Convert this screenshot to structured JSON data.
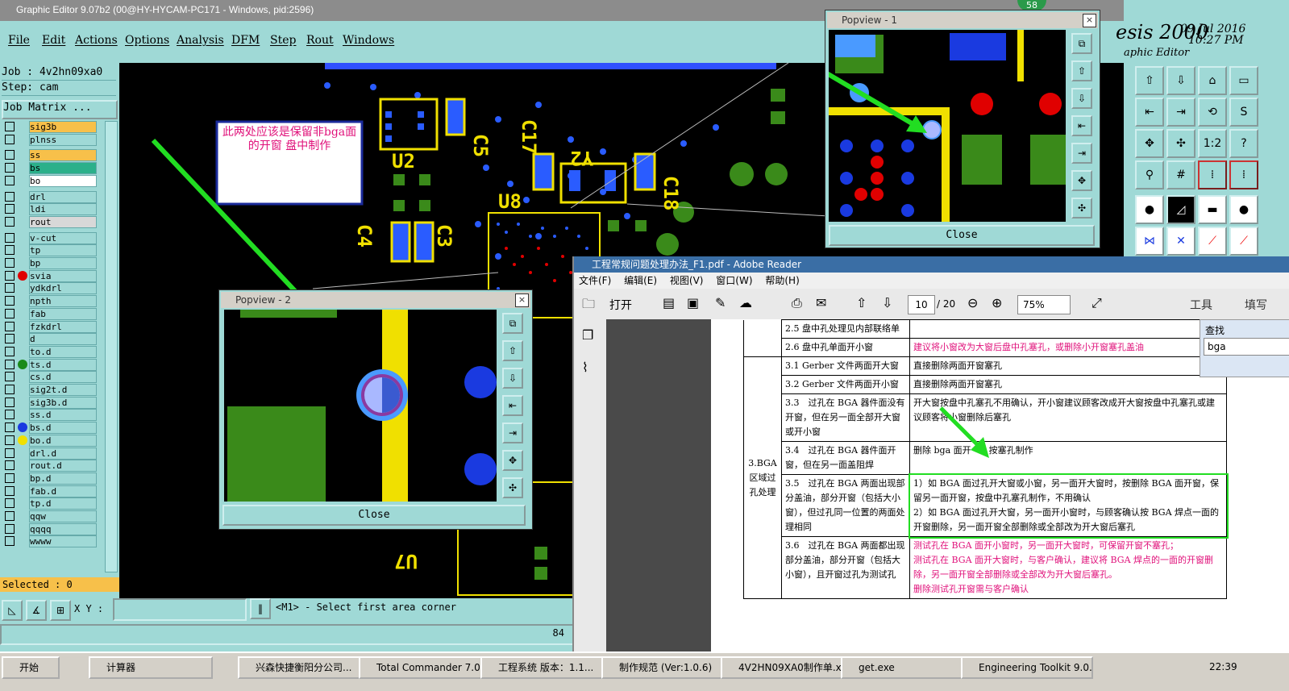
{
  "window": {
    "title": "Graphic Editor 9.07b2 (00@HY-HYCAM-PC171 - Windows, pid:2596)",
    "badge": "58"
  },
  "menu": [
    "File",
    "Edit",
    "Actions",
    "Options",
    "Analysis",
    "DFM",
    "Step",
    "Rout",
    "Windows"
  ],
  "left": {
    "job": "Job : 4v2hn09xa0",
    "step": "Step: cam",
    "job_matrix": "Job Matrix ...",
    "selected": "Selected : 0",
    "layers": [
      {
        "name": "sig3b",
        "bg": "#f7c04a"
      },
      {
        "name": "plnss",
        "bg": "#9fd9d6"
      },
      {
        "name": "ss",
        "bg": "#f7c04a"
      },
      {
        "name": "bs",
        "bg": "#2bb08a"
      },
      {
        "name": "bo",
        "bg": "#ffffff"
      },
      {
        "name": "drl",
        "bg": "#9fd9d6"
      },
      {
        "name": "ldi",
        "bg": "#9fd9d6"
      },
      {
        "name": "rout",
        "bg": "#d8d8d8"
      },
      {
        "name": "v-cut",
        "bg": "#9fd9d6"
      },
      {
        "name": "tp",
        "bg": "#9fd9d6"
      },
      {
        "name": "bp",
        "bg": "#9fd9d6"
      },
      {
        "name": "svia",
        "bg": "#9fd9d6",
        "dot": "#e00000"
      },
      {
        "name": "ydkdrl",
        "bg": "#9fd9d6"
      },
      {
        "name": "npth",
        "bg": "#9fd9d6"
      },
      {
        "name": "fab",
        "bg": "#9fd9d6"
      },
      {
        "name": "fzkdrl",
        "bg": "#9fd9d6"
      },
      {
        "name": "d",
        "bg": "#9fd9d6"
      },
      {
        "name": "to.d",
        "bg": "#9fd9d6"
      },
      {
        "name": "ts.d",
        "bg": "#9fd9d6",
        "dot": "#1a8a1a"
      },
      {
        "name": "cs.d",
        "bg": "#9fd9d6"
      },
      {
        "name": "sig2t.d",
        "bg": "#9fd9d6"
      },
      {
        "name": "sig3b.d",
        "bg": "#9fd9d6"
      },
      {
        "name": "ss.d",
        "bg": "#9fd9d6"
      },
      {
        "name": "bs.d",
        "bg": "#9fd9d6",
        "dot": "#1a3ae0"
      },
      {
        "name": "bo.d",
        "bg": "#9fd9d6",
        "dot": "#f0e000"
      },
      {
        "name": "drl.d",
        "bg": "#9fd9d6"
      },
      {
        "name": "rout.d",
        "bg": "#9fd9d6"
      },
      {
        "name": "bp.d",
        "bg": "#9fd9d6"
      },
      {
        "name": "fab.d",
        "bg": "#9fd9d6"
      },
      {
        "name": "tp.d",
        "bg": "#9fd9d6"
      },
      {
        "name": "qqw",
        "bg": "#9fd9d6"
      },
      {
        "name": "qqqq",
        "bg": "#9fd9d6"
      },
      {
        "name": "wwww",
        "bg": "#9fd9d6"
      }
    ]
  },
  "canvas": {
    "note": "此两处应该是保留非bga面的开窗    盘中制作",
    "labels": [
      "C5",
      "C17",
      "Y2",
      "U2",
      "U8",
      "C18",
      "C4",
      "C3",
      "U7"
    ]
  },
  "bottom": {
    "xy_label": "X Y :",
    "xy_value": "",
    "prompt": "<M1> - Select first area corner",
    "count": "84"
  },
  "brand": {
    "name": "esis 2000",
    "sub": "aphic Editor",
    "date": "09 Jul 2016",
    "time": "10:27 PM"
  },
  "popview1": {
    "title": "Popview - 1",
    "close": "Close"
  },
  "popview2": {
    "title": "Popview - 2",
    "close": "Close"
  },
  "reader": {
    "title": "工程常规问题处理办法_F1.pdf - Adobe Reader",
    "menu": [
      "文件(F)",
      "编辑(E)",
      "视图(V)",
      "窗口(W)",
      "帮助(H)"
    ],
    "open": "打开",
    "page": "10",
    "pages": "/ 20",
    "zoom": "75%",
    "tools": "工具",
    "sign": "填写",
    "find_label": "查找",
    "find_value": "bga",
    "rows": [
      {
        "c": "2.5 盘中孔处理见内部联络单",
        "d": ""
      },
      {
        "c": "2.6 盘中孔单面开小窗",
        "d": "建议将小窗改为大窗后盘中孔塞孔，或删除小开窗塞孔盖油"
      },
      {
        "c": "3.1 Gerber 文件两面开大窗",
        "d": "直接删除两面开窗塞孔"
      },
      {
        "c": "3.2 Gerber 文件两面开小窗",
        "d": "直接删除两面开窗塞孔"
      },
      {
        "c": "3.3　过孔在 BGA 器件面没有开窗，但在另一面全部开大窗或开小窗",
        "d": "开大窗按盘中孔塞孔不用确认，开小窗建议顾客改成开大窗按盘中孔塞孔或建议顾客将小窗删除后塞孔"
      },
      {
        "c": "3.4　过孔在 BGA 器件面开窗，但在另一面盖阻焊",
        "d": "删除 bga 面开　　按塞孔制作"
      },
      {
        "c": "3.5　过孔在 BGA 两面出现部分盖油，部分开窗（包括大小窗），但过孔同一位置的两面处理相同",
        "d": "1）如 BGA 面过孔开大窗或小窗，另一面开大窗时，按删除 BGA 面开窗，保留另一面开窗，按盘中孔塞孔制作，不用确认\n2）如 BGA 面过孔开大窗，另一面开小窗时，与顾客确认按 BGA 焊点一面的开窗删除，另一面开窗全部删除或全部改为开大窗后塞孔"
      },
      {
        "c": "3.6　过孔在 BGA 两面都出现部分盖油，部分开窗（包括大小窗），且开窗过孔为测试孔",
        "d": "测试孔在 BGA 面开小窗时，另一面开大窗时，可保留开窗不塞孔；\n测试孔在 BGA 面开大窗时，与客户确认，建议将 BGA 焊点的一面的开窗删除，另一面开窗全部删除或全部改为开大窗后塞孔。\n删除测试孔开窗需与客户确认"
      }
    ],
    "section": "3.BGA 区域过孔处理"
  },
  "taskbar": {
    "start": "开始",
    "items": [
      "计算器",
      "兴森快捷衡阳分公司...",
      "Total Commander 7.0 ...",
      "工程系统 版本：1.1...",
      "制作规范 (Ver:1.0.6)",
      "4V2HN09XA0制作单.x...",
      "get.exe",
      "Engineering Toolkit 9.0..."
    ],
    "clock": "22:39"
  }
}
